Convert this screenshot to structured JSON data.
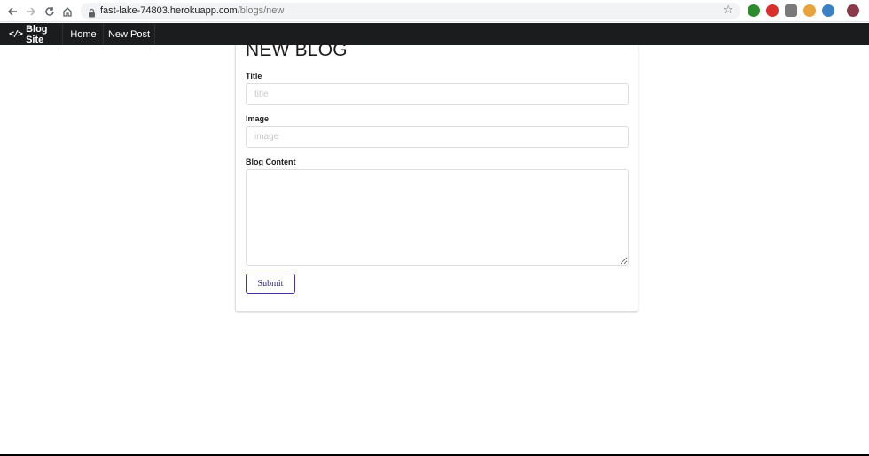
{
  "browser": {
    "url_host": "fast-lake-74803.herokuapp.com",
    "url_path": "/blogs/new",
    "icons": [
      "back-icon",
      "forward-icon",
      "reload-icon",
      "home-icon",
      "lock-icon",
      "star-icon"
    ],
    "extension_colors": [
      "#2e8b2e",
      "#d9302c",
      "#7a7a7a",
      "#e8a33b",
      "#3b82c4",
      "#8a3b4a"
    ]
  },
  "navbar": {
    "brand_icon": "</>",
    "brand_label": "Blog Site",
    "items": [
      {
        "label": "Home"
      },
      {
        "label": "New Post"
      }
    ]
  },
  "form": {
    "heading": "NEW BLOG",
    "title_label": "Title",
    "title_placeholder": "title",
    "image_label": "Image",
    "image_placeholder": "image",
    "content_label": "Blog Content",
    "submit_label": "Submit"
  },
  "colors": {
    "navbar_bg": "#1b1c1d",
    "accent": "#2f2186"
  }
}
